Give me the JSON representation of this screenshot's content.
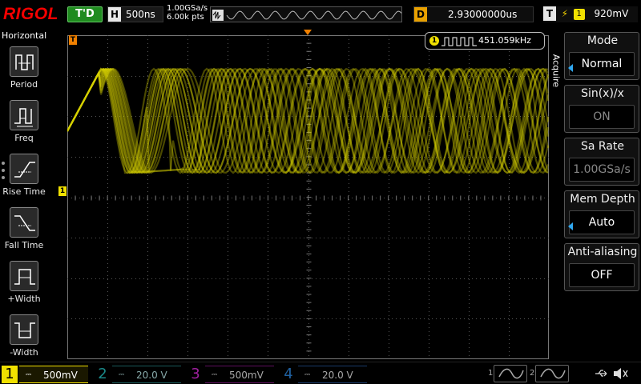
{
  "header": {
    "logo": "RIGOL",
    "run_status": "T'D",
    "horizontal_label": "H",
    "timebase": "500ns",
    "sample_rate": "1.00GSa/s",
    "memory_points": "6.00k pts",
    "delay_label": "D",
    "delay_value": "2.93000000us",
    "trigger_label": "T",
    "trigger_edge": "rising-edge-icon",
    "trigger_source": "1",
    "trigger_level": "920mV"
  },
  "left_panel": {
    "title": "Horizontal",
    "measurements": [
      {
        "label": "Period",
        "icon": "period-icon"
      },
      {
        "label": "Freq",
        "icon": "frequency-icon"
      },
      {
        "label": "Rise Time",
        "icon": "rise-time-icon"
      },
      {
        "label": "Fall Time",
        "icon": "fall-time-icon"
      },
      {
        "label": "+Width",
        "icon": "positive-width-icon"
      },
      {
        "label": "-Width",
        "icon": "negative-width-icon"
      }
    ]
  },
  "screen": {
    "trigger_marker": "T",
    "ch1_marker": "1",
    "level_marker": "T",
    "freq_channel": "1",
    "frequency": "451.059kHz",
    "waveform_color": "#d8d000"
  },
  "right_menu": {
    "tab": "Acquire",
    "items": [
      {
        "label": "Mode",
        "value": "Normal",
        "arrow": true,
        "dim": false
      },
      {
        "label": "Sin(x)/x",
        "value": "ON",
        "arrow": false,
        "dim": true
      },
      {
        "label": "Sa Rate",
        "value": "1.00GSa/s",
        "arrow": false,
        "dim": true
      },
      {
        "label": "Mem Depth",
        "value": "Auto",
        "arrow": true,
        "dim": false
      },
      {
        "label": "Anti-aliasing",
        "value": "OFF",
        "arrow": false,
        "dim": false
      }
    ]
  },
  "channels": [
    {
      "num": "1",
      "scale": "500mV",
      "active": true
    },
    {
      "num": "2",
      "scale": "20.0 V",
      "active": false
    },
    {
      "num": "3",
      "scale": "500mV",
      "active": false
    },
    {
      "num": "4",
      "scale": "20.0 V",
      "active": false
    }
  ],
  "bottom_icons": [
    "generator-1-icon",
    "generator-2-icon",
    "usb-icon",
    "speaker-icon"
  ]
}
